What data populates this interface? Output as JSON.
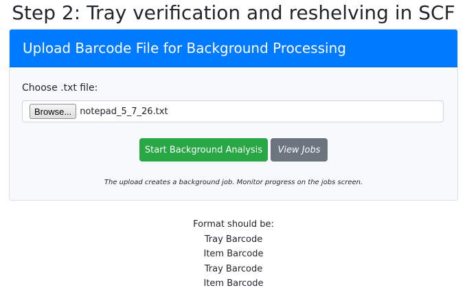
{
  "page": {
    "title": "Step 2: Tray verification and reshelving in SCF"
  },
  "upload_card": {
    "header": "Upload Barcode File for Background Processing",
    "file_label": "Choose .txt file:",
    "browse_label": "Browse...",
    "file_name": "notepad_5_7_26.txt",
    "start_button": "Start Background Analysis",
    "view_jobs_button": "View Jobs",
    "note": "The upload creates a background job. Monitor progress on the jobs screen."
  },
  "format": {
    "heading": "Format should be:",
    "lines": [
      "Tray Barcode",
      "Item Barcode",
      "Tray Barcode",
      "Item Barcode"
    ]
  },
  "colors": {
    "header_blue": "#007bff",
    "success_green": "#28a745",
    "secondary_gray": "#6c757d"
  }
}
